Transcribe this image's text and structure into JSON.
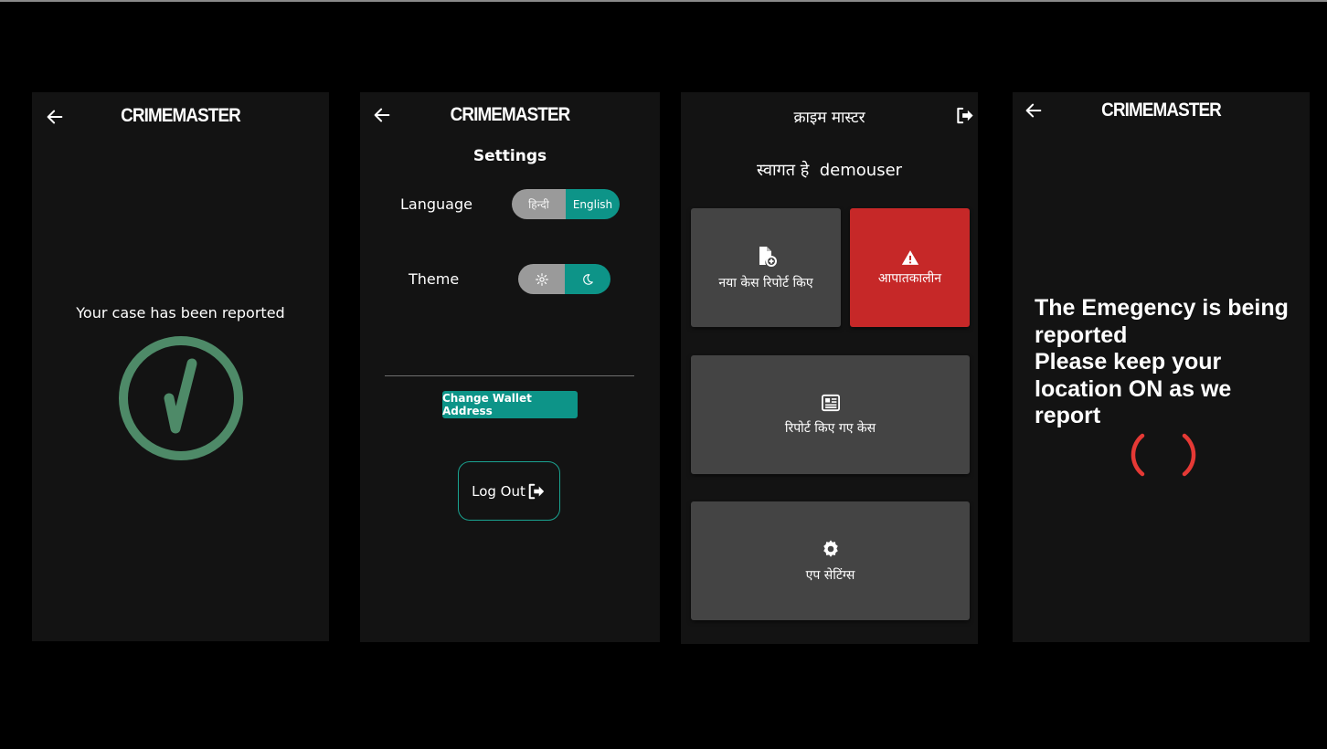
{
  "screen_success": {
    "brand": "CRIMEMASTER",
    "message": "Your case has been reported",
    "check_color": "#4e8a68"
  },
  "screen_settings": {
    "brand": "CRIMEMASTER",
    "title": "Settings",
    "language_label": "Language",
    "language_options": [
      "हिन्दी",
      "English"
    ],
    "language_selected": "English",
    "theme_label": "Theme",
    "theme_options": [
      "light-settings-icon",
      "moon-icon"
    ],
    "theme_selected": "dark",
    "wallet_button": "Change Wallet Address",
    "logout_button": "Log Out",
    "accent": "#0d9488"
  },
  "screen_home": {
    "title": "क्राइम मास्टर",
    "welcome_prefix": "स्वागत हे",
    "username": "demouser",
    "tiles": {
      "new_case": "नया केस रिपोर्ट किए",
      "emergency": "आपातकालीन",
      "reported_cases": "रिपोर्ट किए गए केस",
      "app_settings": "एप सेटिंग्स"
    },
    "emergency_color": "#c62828"
  },
  "screen_emergency": {
    "brand": "CRIMEMASTER",
    "message_lines": [
      "The Emegency is being reported",
      "Please keep your location ON as we report"
    ],
    "spinner_color": "#e53935"
  }
}
